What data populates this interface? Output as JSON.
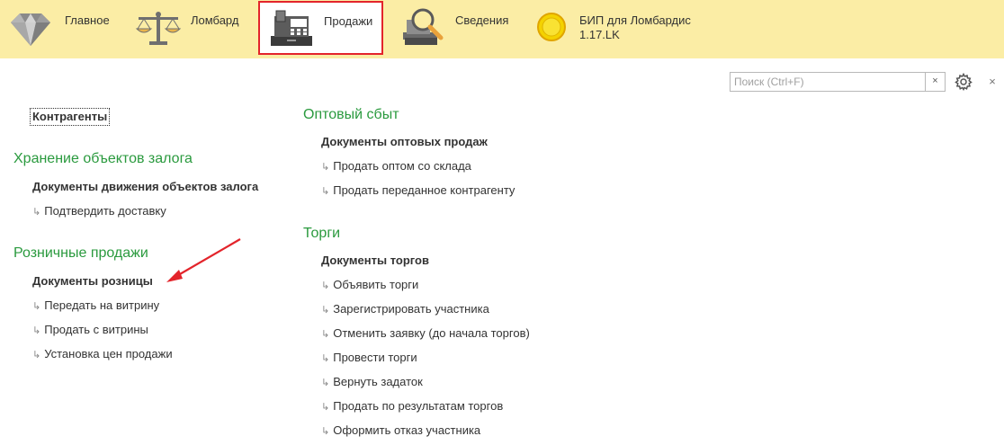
{
  "sections": {
    "main": "Главное",
    "lombard": "Ломбард",
    "sales": "Продажи",
    "info": "Сведения",
    "bip_line1": "БИП для Ломбардис",
    "bip_line2": "1.17.LK"
  },
  "search": {
    "placeholder": "Поиск (Ctrl+F)",
    "value": "",
    "clear": "×"
  },
  "window": {
    "close": "×"
  },
  "colors": {
    "topbar": "#fbeda5",
    "group_title": "#2a9a3e",
    "highlight_border": "#e3242b"
  },
  "left": {
    "kontragenty": "Контрагенты",
    "storage": {
      "title": "Хранение объектов залога",
      "doc": "Документы движения объектов залога",
      "items": [
        "Подтвердить доставку"
      ]
    },
    "retail": {
      "title": "Розничные продажи",
      "doc": "Документы розницы",
      "items": [
        "Передать на витрину",
        "Продать с витрины",
        "Установка цен продажи"
      ]
    }
  },
  "right": {
    "wholesale": {
      "title": "Оптовый сбыт",
      "doc": "Документы оптовых продаж",
      "items": [
        "Продать оптом со склада",
        "Продать переданное контрагенту"
      ]
    },
    "auctions": {
      "title": "Торги",
      "doc": "Документы торгов",
      "items": [
        "Объявить торги",
        "Зарегистрировать участника",
        "Отменить заявку (до начала торгов)",
        "Провести торги",
        "Вернуть задаток",
        "Продать по результатам торгов",
        "Оформить отказ участника"
      ]
    }
  },
  "icons": {
    "main": "diamond-icon",
    "lombard": "scales-icon",
    "sales": "cash-register-icon",
    "info": "books-magnifier-icon",
    "bip": "coin-icon",
    "settings": "gear-icon",
    "item_prefix": "return-arrow-icon"
  }
}
